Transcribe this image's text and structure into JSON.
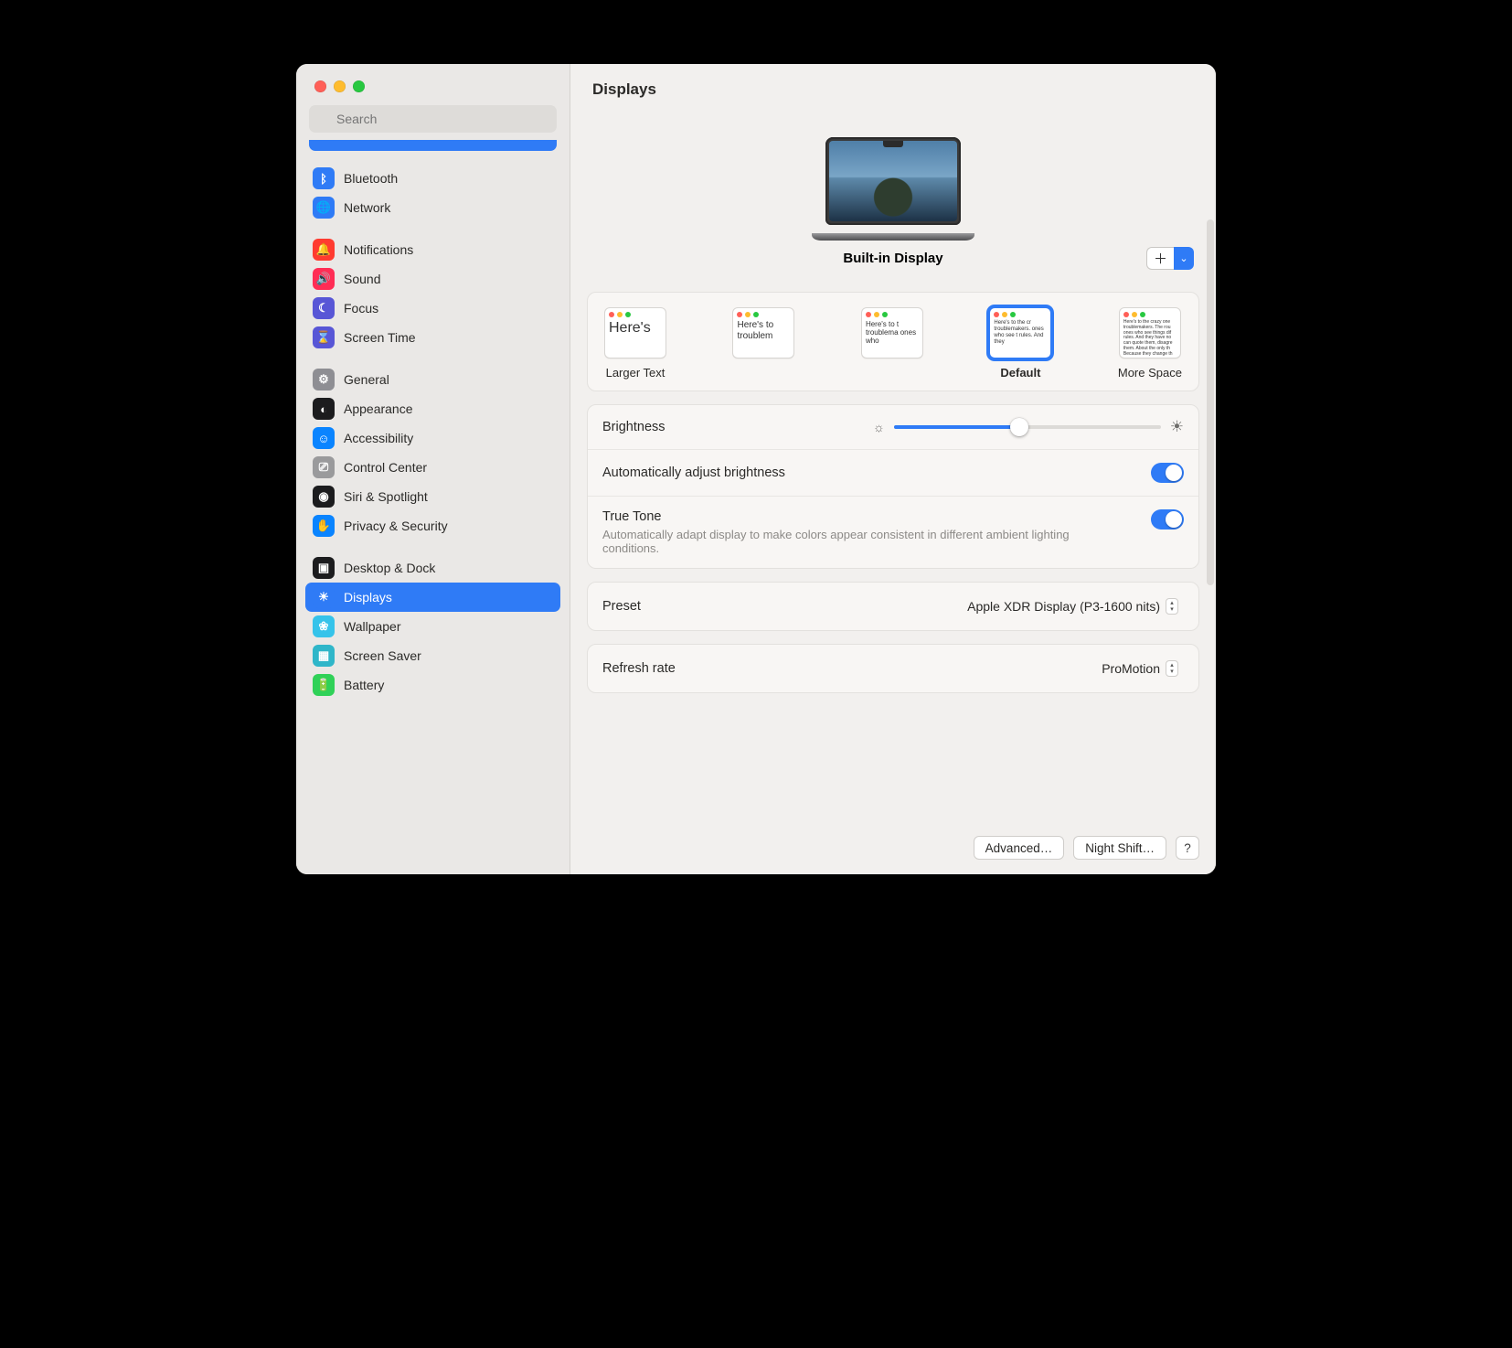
{
  "header": {
    "title": "Displays"
  },
  "search": {
    "placeholder": "Search"
  },
  "sidebar": {
    "clipped_top_item": true,
    "groups": [
      {
        "items": [
          {
            "key": "bluetooth",
            "label": "Bluetooth",
            "iconName": "bluetooth-icon",
            "iconBg": "#2f7bf6",
            "glyph": "ᛒ"
          },
          {
            "key": "network",
            "label": "Network",
            "iconName": "globe-icon",
            "iconBg": "#2f7bf6",
            "glyph": "🌐"
          }
        ]
      },
      {
        "items": [
          {
            "key": "notifications",
            "label": "Notifications",
            "iconName": "bell-icon",
            "iconBg": "#ff3b30",
            "glyph": "🔔"
          },
          {
            "key": "sound",
            "label": "Sound",
            "iconName": "speaker-icon",
            "iconBg": "#ff2d55",
            "glyph": "🔊"
          },
          {
            "key": "focus",
            "label": "Focus",
            "iconName": "moon-icon",
            "iconBg": "#5856d6",
            "glyph": "☾"
          },
          {
            "key": "screentime",
            "label": "Screen Time",
            "iconName": "hourglass-icon",
            "iconBg": "#5856d6",
            "glyph": "⌛"
          }
        ]
      },
      {
        "items": [
          {
            "key": "general",
            "label": "General",
            "iconName": "gear-icon",
            "iconBg": "#8e8e93",
            "glyph": "⚙"
          },
          {
            "key": "appearance",
            "label": "Appearance",
            "iconName": "appearance-icon",
            "iconBg": "#1c1c1e",
            "glyph": "◐"
          },
          {
            "key": "accessibility",
            "label": "Accessibility",
            "iconName": "accessibility-icon",
            "iconBg": "#0a84ff",
            "glyph": "☺"
          },
          {
            "key": "controlcenter",
            "label": "Control Center",
            "iconName": "switches-icon",
            "iconBg": "#9a9a9c",
            "glyph": "⎚"
          },
          {
            "key": "siri",
            "label": "Siri & Spotlight",
            "iconName": "siri-icon",
            "iconBg": "#1c1c1e",
            "glyph": "◉"
          },
          {
            "key": "privacy",
            "label": "Privacy & Security",
            "iconName": "hand-icon",
            "iconBg": "#0a84ff",
            "glyph": "✋"
          }
        ]
      },
      {
        "items": [
          {
            "key": "desktop",
            "label": "Desktop & Dock",
            "iconName": "dock-icon",
            "iconBg": "#1c1c1e",
            "glyph": "▣"
          },
          {
            "key": "displays",
            "label": "Displays",
            "iconName": "brightness-icon",
            "iconBg": "#2f7bf6",
            "glyph": "☀",
            "selected": true
          },
          {
            "key": "wallpaper",
            "label": "Wallpaper",
            "iconName": "wallpaper-icon",
            "iconBg": "#35c3ea",
            "glyph": "❀"
          },
          {
            "key": "screensaver",
            "label": "Screen Saver",
            "iconName": "screensaver-icon",
            "iconBg": "#2fb6c9",
            "glyph": "▦"
          },
          {
            "key": "battery",
            "label": "Battery",
            "iconName": "battery-icon",
            "iconBg": "#30d158",
            "glyph": "🔋"
          }
        ]
      }
    ]
  },
  "display": {
    "name": "Built-in Display"
  },
  "resolution": {
    "options": [
      {
        "key": "larger",
        "label": "Larger Text",
        "sampleSize": 16,
        "sample": "Here's"
      },
      {
        "key": "scale2",
        "label": "",
        "sampleSize": 10,
        "sample": "Here's to troublem"
      },
      {
        "key": "scale3",
        "label": "",
        "sampleSize": 8,
        "sample": "Here's to t troublema ones who"
      },
      {
        "key": "default",
        "label": "Default",
        "sampleSize": 6,
        "sample": "Here's to the cr troublemakers. ones who see t rules. And they",
        "selected": true
      },
      {
        "key": "more",
        "label": "More Space",
        "sampleSize": 5,
        "sample": "Here's to the crazy one troublemakers. The rou ones who see things dif rules. And they have no can quote them, disagre them. About the only th Because they change th"
      }
    ]
  },
  "settings": {
    "brightness": {
      "label": "Brightness",
      "value": 0.47
    },
    "autoBrightness": {
      "label": "Automatically adjust brightness",
      "on": true
    },
    "trueTone": {
      "label": "True Tone",
      "on": true,
      "description": "Automatically adapt display to make colors appear consistent in different ambient lighting conditions."
    },
    "preset": {
      "label": "Preset",
      "value": "Apple XDR Display (P3-1600 nits)"
    },
    "refresh": {
      "label": "Refresh rate",
      "value": "ProMotion"
    }
  },
  "footer": {
    "advanced": "Advanced…",
    "nightShift": "Night Shift…"
  }
}
